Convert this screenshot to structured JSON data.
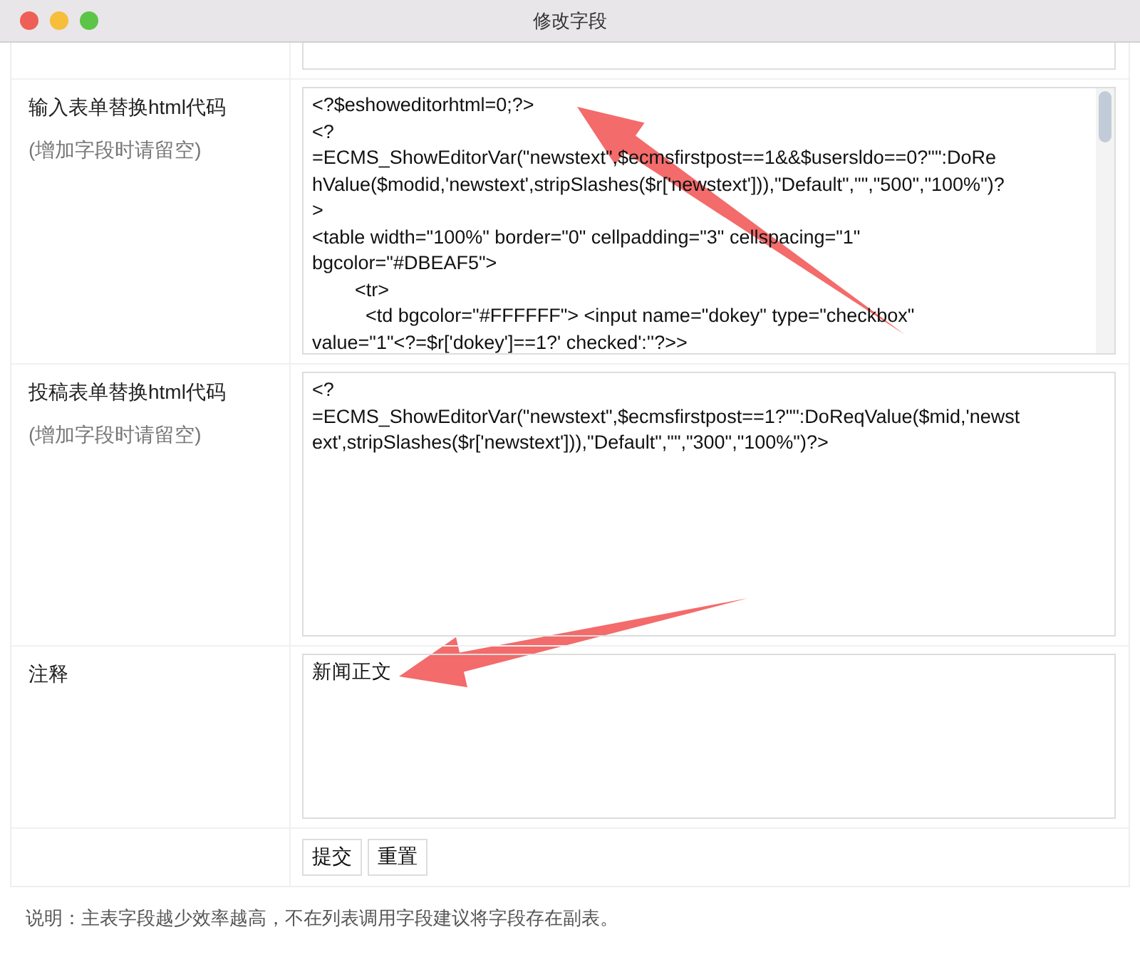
{
  "window": {
    "title": "修改字段"
  },
  "fields": [
    {
      "label": "输入表单替换html代码",
      "hint": "(增加字段时请留空)",
      "scrollable": true,
      "lines": [
        "<?$eshoweditorhtml=0;?>",
        "<?",
        "=ECMS_ShowEditorVar(\"newstext\",$ecmsfirstpost==1&&$usersldo==0?\"\":DoRe",
        "hValue($modid,'newstext',stripSlashes($r['newstext'])),\"Default\",\"\",\"500\",\"100%\")?",
        ">",
        "<table width=\"100%\" border=\"0\" cellpadding=\"3\" cellspacing=\"1\"",
        "bgcolor=\"#DBEAF5\">",
        "        <tr>",
        "          <td bgcolor=\"#FFFFFF\"> <input name=\"dokey\" type=\"checkbox\"",
        "value=\"1\"<?=$r['dokey']==1?' checked':''?>>"
      ]
    },
    {
      "label": "投稿表单替换html代码",
      "hint": "(增加字段时请留空)",
      "scrollable": false,
      "lines": [
        "<?",
        "=ECMS_ShowEditorVar(\"newstext\",$ecmsfirstpost==1?\"\":DoReqValue($mid,'newst",
        "ext',stripSlashes($r['newstext'])),\"Default\",\"\",\"300\",\"100%\")?>"
      ]
    },
    {
      "label": "注释",
      "scrollable": false,
      "lines": [
        "新闻正文"
      ]
    }
  ],
  "buttons": [
    "提交",
    "重置"
  ],
  "note": "说明：主表字段越少效率越高，不在列表调用字段建议将字段存在副表。"
}
